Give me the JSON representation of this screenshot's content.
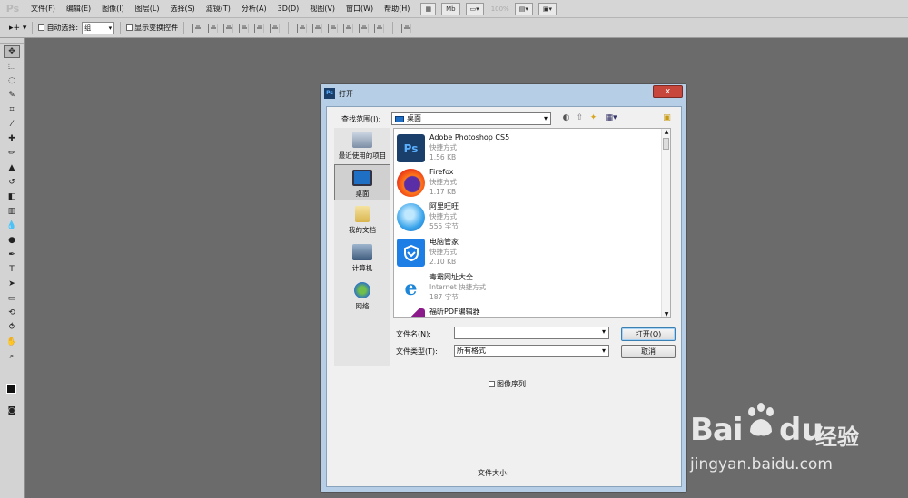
{
  "app": {
    "logo": "Ps",
    "menu": [
      "文件(F)",
      "编辑(E)",
      "图像(I)",
      "图层(L)",
      "选择(S)",
      "滤镜(T)",
      "分析(A)",
      "3D(D)",
      "视图(V)",
      "窗口(W)",
      "帮助(H)"
    ],
    "zoom": "100%",
    "mb_badge": "Mb"
  },
  "options": {
    "auto_select_label": "自动选择:",
    "auto_select_value": "组",
    "show_transform_label": "显示变换控件"
  },
  "dialog": {
    "title": "打开",
    "close_glyph": "x",
    "look_in_label": "查找范围(I):",
    "look_in_value": "桌面",
    "places": [
      "最近使用的项目",
      "桌面",
      "我的文档",
      "计算机",
      "网络"
    ],
    "files": [
      {
        "name": "Adobe Photoshop CS5",
        "type": "快捷方式",
        "size": "1.56 KB",
        "icon": "Ps"
      },
      {
        "name": "Firefox",
        "type": "快捷方式",
        "size": "1.17 KB",
        "icon": ""
      },
      {
        "name": "阿里旺旺",
        "type": "快捷方式",
        "size": "555 字节",
        "icon": ""
      },
      {
        "name": "电脑管家",
        "type": "快捷方式",
        "size": "2.10 KB",
        "icon": ""
      },
      {
        "name": "毒霸网址大全",
        "type": "Internet 快捷方式",
        "size": "187 字节",
        "icon": "e"
      },
      {
        "name": "福昕PDF编辑器",
        "type": "",
        "size": "",
        "icon": ""
      }
    ],
    "file_name_label": "文件名(N):",
    "file_name_value": "",
    "file_type_label": "文件类型(T):",
    "file_type_value": "所有格式",
    "open_button": "打开(O)",
    "cancel_button": "取消",
    "image_sequence_label": "图像序列",
    "file_size_label": "文件大小:"
  },
  "watermark": {
    "brand": "Bai",
    "brand2": "du",
    "cn": "经验",
    "url": "jingyan.baidu.com"
  },
  "colors": {
    "dialog_frame": "#b7cfe6",
    "ps_blue": "#1b3f6b",
    "close_red": "#c8473c"
  }
}
